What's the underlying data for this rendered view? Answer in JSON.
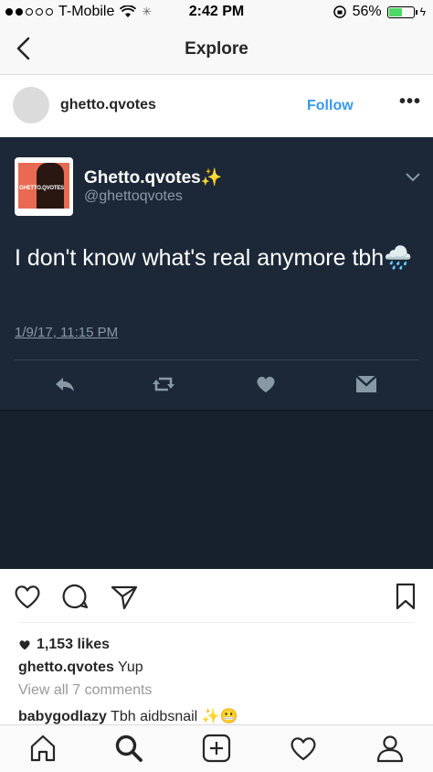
{
  "status_bar": {
    "carrier": "T-Mobile",
    "time": "2:42 PM",
    "battery": "56%",
    "battery_level": 0.56
  },
  "nav": {
    "title": "Explore",
    "back_icon": "chevron-left-icon"
  },
  "post_header": {
    "username": "ghetto.qvotes",
    "follow_label": "Follow",
    "more_label": "•••"
  },
  "tweet": {
    "display_name": "Ghetto.qvotes✨",
    "handle": "@ghettoqvotes",
    "avatar_text": "GHETTO.QVOTES",
    "text": "I don't know what's real anymore tbh🌧️",
    "date": "1/9/17, 11:15 PM",
    "colors": {
      "background": "#1c2838",
      "text": "#ffffff",
      "muted": "#8899a6"
    }
  },
  "post_footer": {
    "likes": "1,153 likes",
    "caption_user": "ghetto.qvotes",
    "caption_text": "Yup",
    "view_all": "View all 7 comments",
    "comment_user": "babygodlazy",
    "comment_text": "Tbh aidbsnail ✨😬"
  },
  "accent_color": "#3897f0"
}
